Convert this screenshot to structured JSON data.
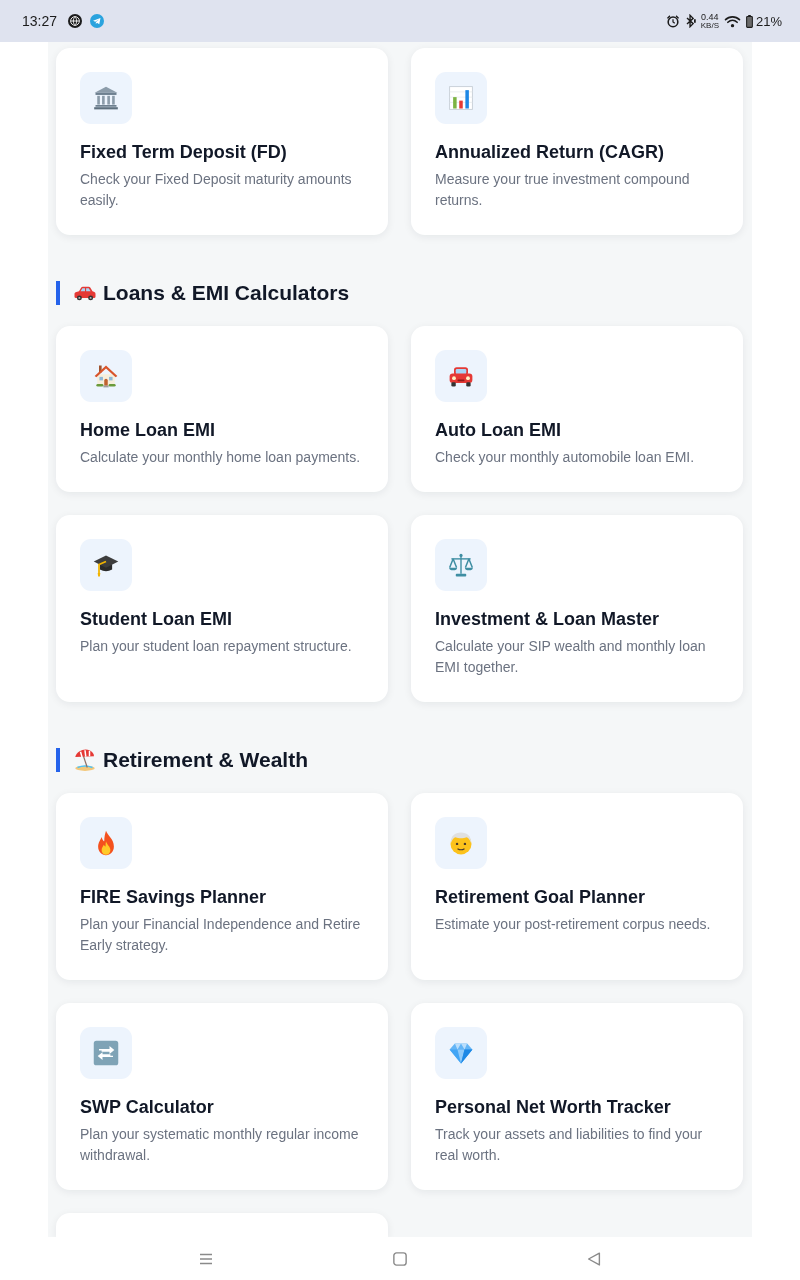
{
  "status_bar": {
    "time": "13:27",
    "net_speed": "0.44",
    "net_speed_unit": "KB/S",
    "battery": "21%"
  },
  "sections": [
    {
      "cards": [
        {
          "title": "Fixed Term Deposit (FD)",
          "description": "Check your Fixed Deposit maturity amounts easily."
        },
        {
          "title": "Annualized Return (CAGR)",
          "description": "Measure your true investment compound returns."
        }
      ]
    },
    {
      "title": "Loans & EMI Calculators",
      "cards": [
        {
          "title": "Home Loan EMI",
          "description": "Calculate your monthly home loan payments."
        },
        {
          "title": "Auto Loan EMI",
          "description": "Check your monthly automobile loan EMI."
        },
        {
          "title": "Student Loan EMI",
          "description": "Plan your student loan repayment structure."
        },
        {
          "title": "Investment & Loan Master",
          "description": "Calculate your SIP wealth and monthly loan EMI together."
        }
      ]
    },
    {
      "title": "Retirement & Wealth",
      "cards": [
        {
          "title": "FIRE Savings Planner",
          "description": "Plan your Financial Independence and Retire Early strategy."
        },
        {
          "title": "Retirement Goal Planner",
          "description": "Estimate your post-retirement corpus needs."
        },
        {
          "title": "SWP Calculator",
          "description": "Plan your systematic monthly regular income withdrawal."
        },
        {
          "title": "Personal Net Worth Tracker",
          "description": "Track your assets and liabilities to find your real worth."
        }
      ],
      "more_below": true
    }
  ]
}
